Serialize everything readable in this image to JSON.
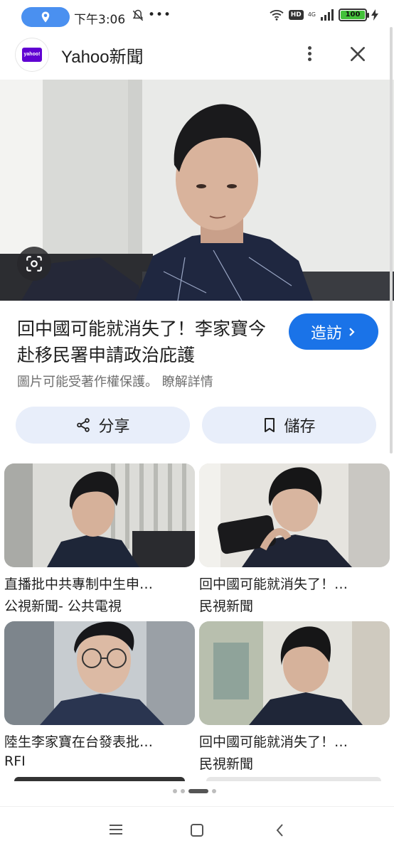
{
  "status_bar": {
    "time": "下午3:06",
    "battery": "100",
    "network": "4G"
  },
  "app": {
    "logo_text": "yahoo!",
    "title": "Yahoo新聞"
  },
  "article": {
    "headline": "回中國可能就消失了！李家寶今赴移民署申請政治庇護",
    "visit_label": "造訪",
    "copyright_note": "圖片可能受著作權保護。 瞭解詳情",
    "share_label": "分享",
    "save_label": "儲存"
  },
  "related": [
    {
      "title": "直播批中共專制中生申…",
      "source": "公視新聞- 公共電視"
    },
    {
      "title": "回中國可能就消失了！…",
      "source": "民視新聞"
    },
    {
      "title": "陸生李家寶在台發表批…",
      "source": "RFI"
    },
    {
      "title": "回中國可能就消失了！…",
      "source": "民視新聞"
    }
  ],
  "pager": {
    "count": 4,
    "active_index": 2
  },
  "colors": {
    "accent": "#1a73e8",
    "button_bg": "#e8eefa",
    "brand": "#6001d2",
    "status_pill": "#4a90f0"
  },
  "icons": [
    "location-icon",
    "mute-icon",
    "wifi-icon",
    "signal-icon",
    "battery-icon",
    "more-vert-icon",
    "close-icon",
    "lens-icon",
    "chevron-right-icon",
    "share-icon",
    "bookmark-icon",
    "menu-icon",
    "home-icon",
    "back-icon"
  ]
}
